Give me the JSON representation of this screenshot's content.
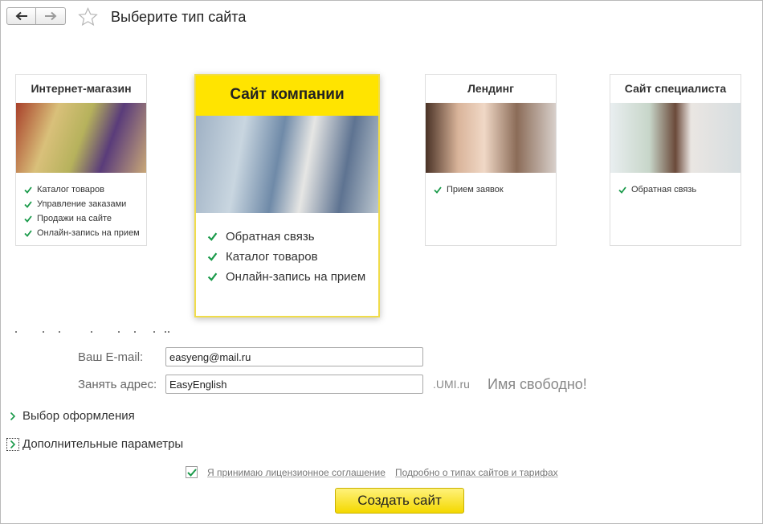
{
  "header": {
    "title": "Выберите тип сайта"
  },
  "cards": [
    {
      "title": "Интернет-магазин",
      "features": [
        "Каталог товаров",
        "Управление заказами",
        "Продажи на сайте",
        "Онлайн-запись на прием"
      ]
    },
    {
      "title": "Сайт компании",
      "features": [
        "Обратная связь",
        "Каталог товаров",
        "Онлайн-запись на прием"
      ]
    },
    {
      "title": "Лендинг",
      "features": [
        "Прием заявок"
      ]
    },
    {
      "title": "Сайт специалиста",
      "features": [
        "Обратная связь"
      ]
    }
  ],
  "selected_card": "Сайт компании",
  "form": {
    "email_label": "Ваш E-mail:",
    "email_value": "easyeng@mail.ru",
    "address_label": "Занять адрес:",
    "address_value": "EasyEnglish",
    "domain_suffix": ".UMI.ru",
    "address_status": "Имя свободно!"
  },
  "sections": {
    "design": "Выбор оформления",
    "advanced": "Дополнительные параметры"
  },
  "agreement": {
    "checked": true,
    "license_link": "Я принимаю лицензионное  соглашение",
    "info_link": "Подробно о типах сайтов и тарифах"
  },
  "submit_label": "Создать сайт",
  "colors": {
    "accent_yellow": "#ffe400",
    "check_green": "#1a9a4a",
    "label_gray": "#666666"
  },
  "icons": [
    "back-arrow-icon",
    "forward-arrow-icon",
    "star-icon",
    "check-icon",
    "chevron-right-icon"
  ]
}
